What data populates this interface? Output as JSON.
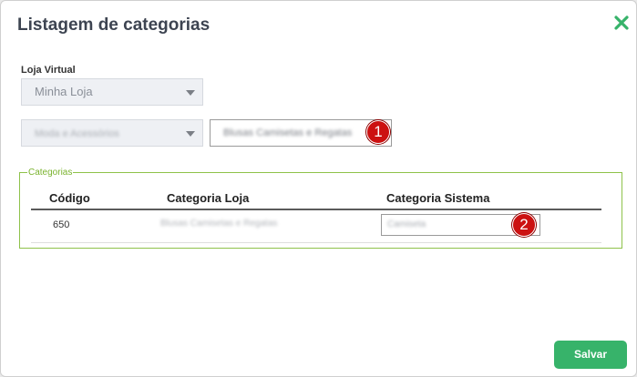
{
  "modal": {
    "title": "Listagem de categorias",
    "close_icon": "close-x-icon",
    "accent_color": "#37b36a"
  },
  "form": {
    "store_label": "Loja Virtual",
    "store_select_value": "Minha Loja",
    "segment_select_value": "Moda e Acessórios",
    "store_category_value": "Blusas Camisetas e Regatas"
  },
  "annotations": {
    "badge_1": "1",
    "badge_2": "2",
    "badge_color": "#cc1111"
  },
  "categories": {
    "legend": "Categorias",
    "columns": [
      "Código",
      "Categoria Loja",
      "Categoria Sistema"
    ],
    "rows": [
      {
        "codigo": "650",
        "categoria_loja": "Blusas Camisetas e Regatas",
        "categoria_sistema": "Camiseta"
      }
    ]
  },
  "footer": {
    "save_label": "Salvar"
  }
}
